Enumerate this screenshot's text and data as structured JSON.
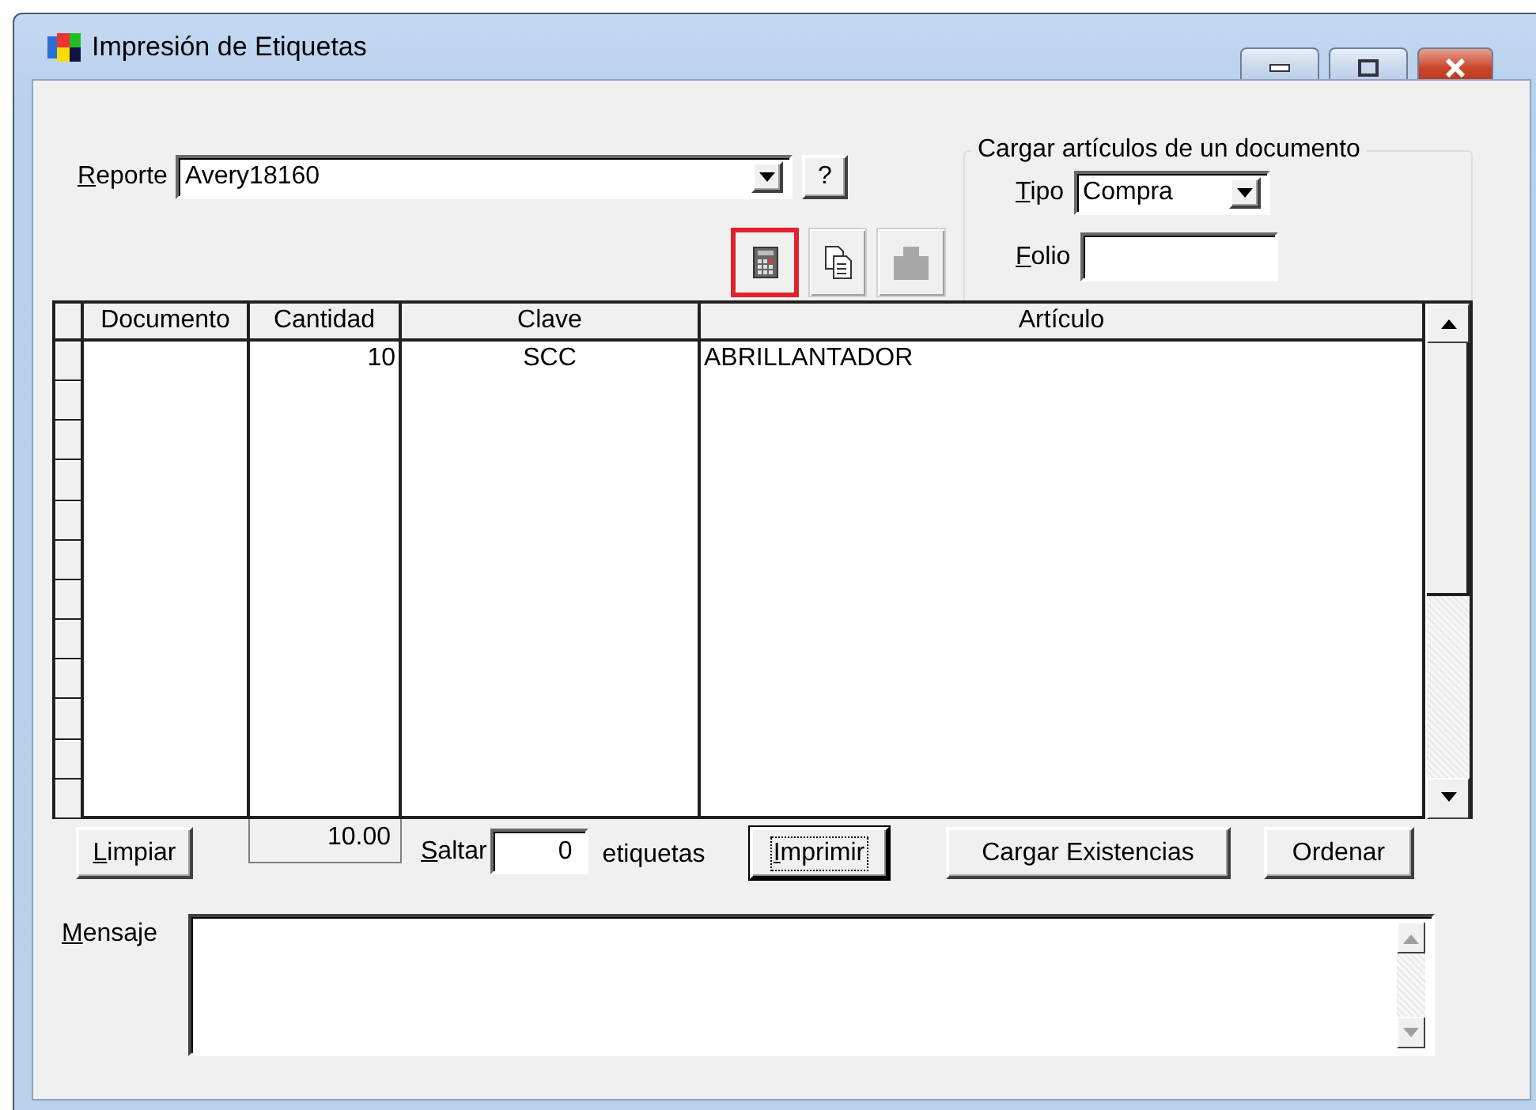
{
  "window": {
    "title": "Impresión de Etiquetas"
  },
  "report": {
    "label": "Reporte",
    "value": "Avery18160",
    "help_button": "?"
  },
  "load_group": {
    "title": "Cargar artículos de un documento",
    "type_label": "Tipo",
    "type_value": "Compra",
    "folio_label": "Folio"
  },
  "toolbar": [
    {
      "kind": "calculator",
      "highlighted": true,
      "disabled": false
    },
    {
      "kind": "copy",
      "highlighted": false,
      "disabled": false
    },
    {
      "kind": "stamp",
      "highlighted": false,
      "disabled": true
    }
  ],
  "table": {
    "columns": [
      {
        "label": "Documento"
      },
      {
        "label": "Cantidad"
      },
      {
        "label": "Clave"
      },
      {
        "label": "Artículo"
      }
    ],
    "rows": [
      {
        "cells": [
          null,
          "10",
          "SCC",
          "ABRILLANTADOR"
        ]
      }
    ]
  },
  "clear_button": "Limpiar",
  "total": "10.00",
  "skip": {
    "label": "Saltar",
    "value": "0",
    "suffix": "etiquetas"
  },
  "print_button": {
    "label": "Imprimir",
    "focused": true
  },
  "load_stock_button": "Cargar Existencias",
  "sort_button": "Ordenar",
  "message": {
    "label": "Mensaje"
  }
}
